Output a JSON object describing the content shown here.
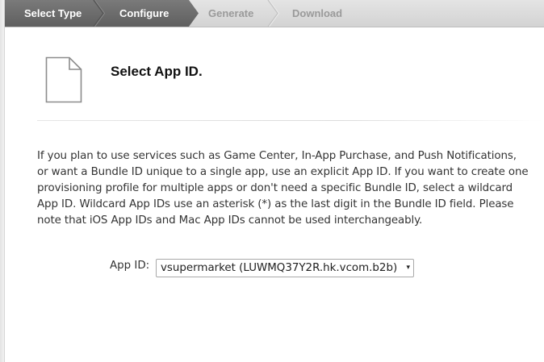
{
  "steps": [
    {
      "label": "Select Type",
      "state": "done"
    },
    {
      "label": "Configure",
      "state": "current"
    },
    {
      "label": "Generate",
      "state": "upcoming"
    },
    {
      "label": "Download",
      "state": "upcoming"
    }
  ],
  "header": {
    "icon": "document-icon",
    "title": "Select App ID."
  },
  "description": {
    "lines": [
      "If you plan to use services such as Game Center, In-App Purchase, and Push Notifications,",
      "or want a Bundle ID unique to a single app, use an explicit App ID. If you want to create one",
      "provisioning profile for multiple apps or don't need a specific Bundle ID, select a wildcard",
      "App ID. Wildcard App IDs use an asterisk (*) as the last digit in the Bundle ID field. Please",
      "note that iOS App IDs and Mac App IDs cannot be used interchangeably."
    ]
  },
  "app_id_field": {
    "label": "App ID:",
    "selected": "vsupermarket (LUWMQ37Y2R.hk.vcom.b2b)",
    "arrow": "▾"
  },
  "colors": {
    "step_active": "#6e6e6e",
    "step_inactive": "#d6d6d6",
    "step_text_active": "#ffffff",
    "step_text_inactive": "#9a9a9a"
  }
}
